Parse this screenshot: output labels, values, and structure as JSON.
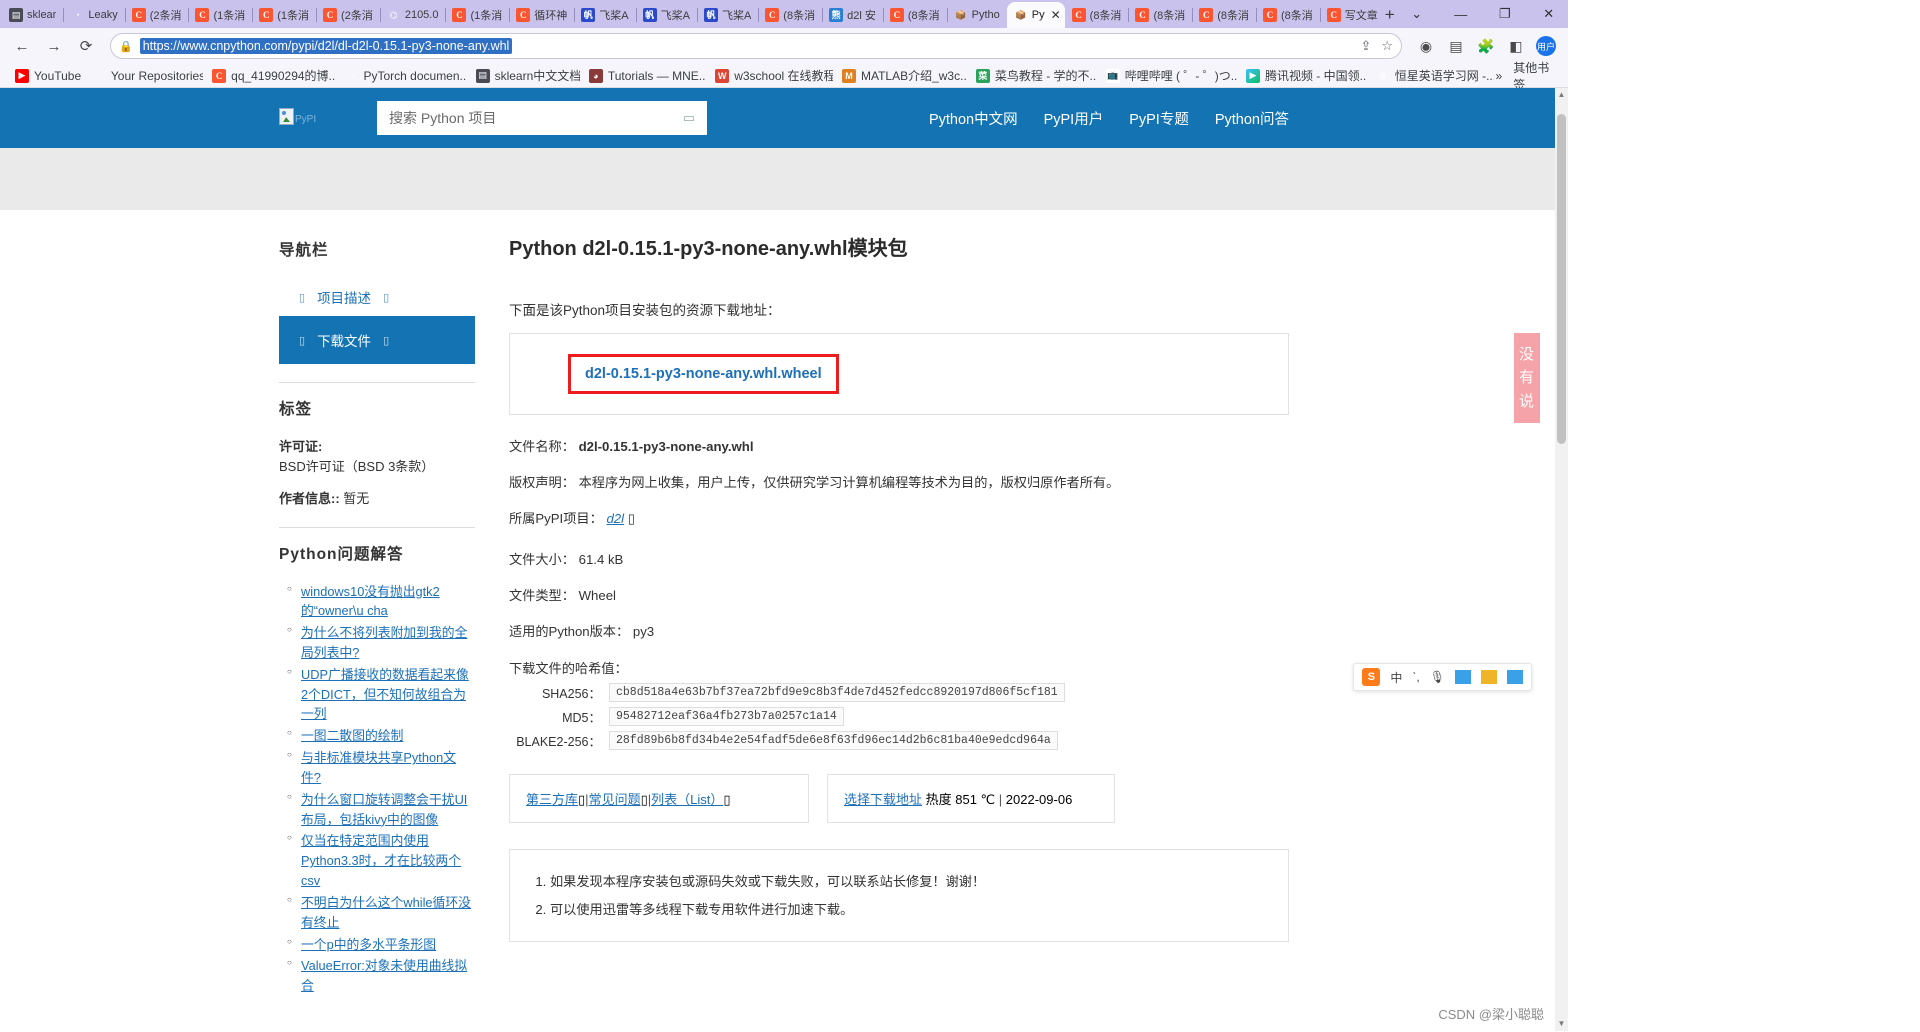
{
  "browser": {
    "tabs": [
      {
        "label": "sklear",
        "icon": "sklearn-icon",
        "active": false
      },
      {
        "label": "Leaky",
        "icon": "leaky-icon",
        "active": false
      },
      {
        "label": "(2条消",
        "icon": "csdn-icon",
        "active": false
      },
      {
        "label": "(1条消",
        "icon": "csdn-icon",
        "active": false
      },
      {
        "label": "(1条消",
        "icon": "csdn-icon",
        "active": false
      },
      {
        "label": "(2条消",
        "icon": "csdn-icon",
        "active": false
      },
      {
        "label": "2105.0",
        "icon": "arxiv-icon",
        "active": false
      },
      {
        "label": "(1条消",
        "icon": "csdn-icon",
        "active": false
      },
      {
        "label": "循环神",
        "icon": "csdn-icon",
        "active": false
      },
      {
        "label": "飞桨A",
        "icon": "paddle-icon",
        "active": false
      },
      {
        "label": "飞桨A",
        "icon": "paddle-icon",
        "active": false
      },
      {
        "label": "飞桨A",
        "icon": "paddle-icon",
        "active": false
      },
      {
        "label": "(8条消",
        "icon": "csdn-icon",
        "active": false
      },
      {
        "label": "d2l 安",
        "icon": "baidu-icon",
        "active": false
      },
      {
        "label": "(8条消",
        "icon": "csdn-icon",
        "active": false
      },
      {
        "label": "Pytho",
        "icon": "python-pkg-icon",
        "active": false
      },
      {
        "label": "Py",
        "icon": "python-pkg-icon",
        "active": true,
        "close": "✕"
      },
      {
        "label": "(8条消",
        "icon": "csdn-icon",
        "active": false
      },
      {
        "label": "(8条消",
        "icon": "csdn-icon",
        "active": false
      },
      {
        "label": "(8条消",
        "icon": "csdn-icon",
        "active": false
      },
      {
        "label": "(8条消",
        "icon": "csdn-icon",
        "active": false
      },
      {
        "label": "写文章",
        "icon": "csdn-icon",
        "active": false
      }
    ],
    "new_tab_label": "+",
    "window_controls": {
      "tablist": "⌄",
      "minimize": "—",
      "maximize": "❐",
      "close": "✕"
    },
    "toolbar": {
      "back": "←",
      "forward": "→",
      "reload": "⟳",
      "lock_icon": "🔒",
      "url": "https://www.cnpython.com/pypi/d2l/dl-d2l-0.15.1-py3-none-any.whl",
      "share_icon": "⇪",
      "bookmark_star": "☆",
      "extension_icons": [
        "profile-circle-icon",
        "reading-list-icon",
        "puzzle-icon",
        "sidepanel-icon"
      ],
      "avatar_label": "用户"
    },
    "bookmarks": [
      {
        "label": "YouTube",
        "icon": "youtube-icon"
      },
      {
        "label": "Your Repositories",
        "icon": "plain-icon"
      },
      {
        "label": "qq_41990294的博...",
        "icon": "csdn-icon"
      },
      {
        "label": "PyTorch documen...",
        "icon": "pytorch-icon"
      },
      {
        "label": "sklearn中文文档",
        "icon": "sklearn-icon"
      },
      {
        "label": "Tutorials — MNE...",
        "icon": "mne-icon"
      },
      {
        "label": "w3school 在线教程",
        "icon": "w3school-icon"
      },
      {
        "label": "MATLAB介绍_w3c...",
        "icon": "matlab-icon"
      },
      {
        "label": "菜鸟教程 - 学的不...",
        "icon": "runoob-icon"
      },
      {
        "label": "哔哩哔哩 ( ゜- ゜)つ...",
        "icon": "bilibili-icon"
      },
      {
        "label": "腾讯视频 - 中国领...",
        "icon": "tencent-video-icon"
      },
      {
        "label": "恒星英语学习网 -...",
        "icon": "plain-icon"
      }
    ],
    "bookmarks_overflow": "»",
    "other_bookmarks": "其他书签",
    "other_bookmarks_icon": "folder-icon"
  },
  "site": {
    "header": {
      "logo_text": "PyPI",
      "search_placeholder": "搜索 Python 项目",
      "search_icon": "search-icon",
      "nav": [
        "Python中文网",
        "PyPI用户",
        "PyPI专题",
        "Python问答"
      ]
    },
    "sidebar": {
      "nav_heading": "导航栏",
      "nav_items": [
        {
          "label": "项目描述",
          "active": false,
          "left_icon": "doc-icon",
          "right_icon": "link-icon"
        },
        {
          "label": "下载文件",
          "active": true,
          "left_icon": "download-icon",
          "right_icon": "link-icon"
        }
      ],
      "tags_heading": "标签",
      "license_key": "许可证:",
      "license_value": "BSD许可证（BSD 3条款）",
      "author_key": "作者信息::",
      "author_value": "暂无",
      "qa_heading": "Python问题解答",
      "qa_links": [
        "windows10没有抛出gtk2的“owner\\u cha",
        "为什么不将列表附加到我的全局列表中?",
        "UDP广播接收的数据看起来像2个DICT，但不知何故组合为一列",
        "一图二散图的绘制",
        "与非标准模块共享Python文件?",
        "为什么窗口旋转调整会干扰UI布局，包括kivy中的图像",
        "仅当在特定范围内使用Python3.3时，才在比较两个csv",
        "不明白为什么这个while循环没有终止",
        "一个p中的多水平条形图",
        "ValueError:对象未使用曲线拟合"
      ]
    },
    "main": {
      "title": "Python d2l-0.15.1-py3-none-any.whl模块包",
      "lead": "下面是该Python项目安装包的资源下载地址：",
      "download_link": "d2l-0.15.1-py3-none-any.whl.wheel",
      "meta": [
        {
          "key": "文件名称：",
          "value": "d2l-0.15.1-py3-none-any.whl",
          "bold": true
        },
        {
          "key": "版权声明：",
          "value": "本程序为网上收集，用户上传，仅供研究学习计算机编程等技术为目的，版权归原作者所有。",
          "bold": false
        },
        {
          "key": "所属PyPI项目：",
          "value": "d2l",
          "link": true
        },
        {
          "key": "文件大小：",
          "value": "61.4 kB",
          "bold": false
        },
        {
          "key": "文件类型：",
          "value": "Wheel",
          "bold": false
        },
        {
          "key": "适用的Python版本：",
          "value": "py3",
          "bold": false
        }
      ],
      "hash_title": "下载文件的哈希值：",
      "hashes": [
        {
          "key": "SHA256：",
          "value": "cb8d518a4e63b7bf37ea72bfd9e9c8b3f4de7d452fedcc8920197d806f5cf181"
        },
        {
          "key": "MD5：",
          "value": "95482712eaf36a4fb273b7a0257c1a14"
        },
        {
          "key": "BLAKE2-256：",
          "value": "28fd89b6b8fd34b4e2e54fadf5de6e8f63fd96ec14d2b6c81ba40e9edcd964a"
        }
      ],
      "panel_left": {
        "links": [
          "第三方库",
          "常见问题",
          "列表（List）"
        ],
        "separator": "|",
        "trailing_icon": "external-link-icon"
      },
      "panel_right": {
        "link": "选择下载地址",
        "heat_label": "热度 851 ℃",
        "separator": "|",
        "date": "2022-09-06"
      },
      "notes": [
        "如果发现本程序安装包或源码失效或下载失败，可以联系站长修复！谢谢！",
        "可以使用迅雷等多线程下载专用软件进行加速下载。"
      ]
    },
    "side_tab_text": "没有说",
    "ime": {
      "logo": "S",
      "mode": "中",
      "items": [
        "comma-icon",
        "mic-icon",
        "keyboard-icon",
        "toolbox-icon",
        "apps-icon"
      ]
    },
    "watermark": "CSDN @梁小聪聪"
  }
}
